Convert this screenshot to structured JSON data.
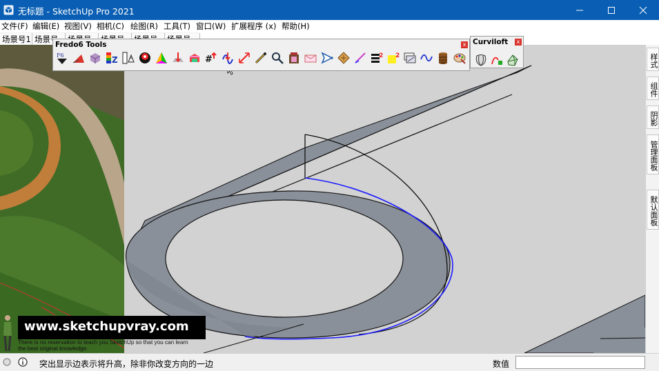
{
  "window": {
    "title": "无标题 - SketchUp Pro 2021",
    "icon": "sketchup-icon",
    "controls": [
      "minimize-icon",
      "maximize-icon",
      "close-icon"
    ]
  },
  "menu": [
    "文件(F)",
    "编辑(E)",
    "视图(V)",
    "相机(C)",
    "绘图(R)",
    "工具(T)",
    "窗口(W)",
    "扩展程序 (x)",
    "帮助(H)"
  ],
  "scene_tabs": [
    "场景号1",
    "场景号",
    "场景号",
    "场景号",
    "场景号",
    "场景号"
  ],
  "fredo_toolbar": {
    "title": "Fredo6 Tools",
    "close": "x",
    "tools": [
      "fredo-scale-icon",
      "curviloft-red-icon",
      "joint-pushpull-icon",
      "toolsonsurface-icon",
      "round-corner-icon",
      "thrupaint-icon",
      "fredocorner-icon",
      "twister-icon",
      "sectioncut-icon",
      "revisor-icon",
      "animator-icon",
      "fredoscale-tag-icon",
      "tubes-icon",
      "bezier-curve-icon",
      "shrink-icon",
      "pen-icon",
      "magnifier-icon",
      "cabinet-icon",
      "mailbox-icon",
      "triangle-cursor-icon",
      "fredo-spider-icon",
      "ruler-pencil-icon",
      "list-number-icon",
      "squared-yellow-icon",
      "projector-icon",
      "wave-curve-icon",
      "barrel-icon",
      "palette-icon"
    ]
  },
  "curviloft_toolbar": {
    "title": "Curviloft",
    "close": "x",
    "tools": [
      "loft-by-spline-icon",
      "skin-contours-icon",
      "loft-along-path-icon"
    ]
  },
  "tray_tabs": [
    "样式",
    "组件",
    "阴影",
    "管理面板",
    "默认面板"
  ],
  "status": {
    "hint_icon": "info-icon",
    "help_icon": "help-circle-icon",
    "text": "突出显示边表示将升高，除非你改变方向的一边",
    "vcb_label": "数值",
    "vcb_value": ""
  },
  "watermark": {
    "url": "www.sketchupvray.com",
    "line1": "There is no reservation to teach you SketchUp so that you can learn",
    "line2": "the best original knowledge."
  },
  "colors": {
    "titlebar": "#0a5fb4",
    "viewport": "#d2d2d2",
    "face": "#8a9099",
    "selection": "#1a1aff"
  }
}
